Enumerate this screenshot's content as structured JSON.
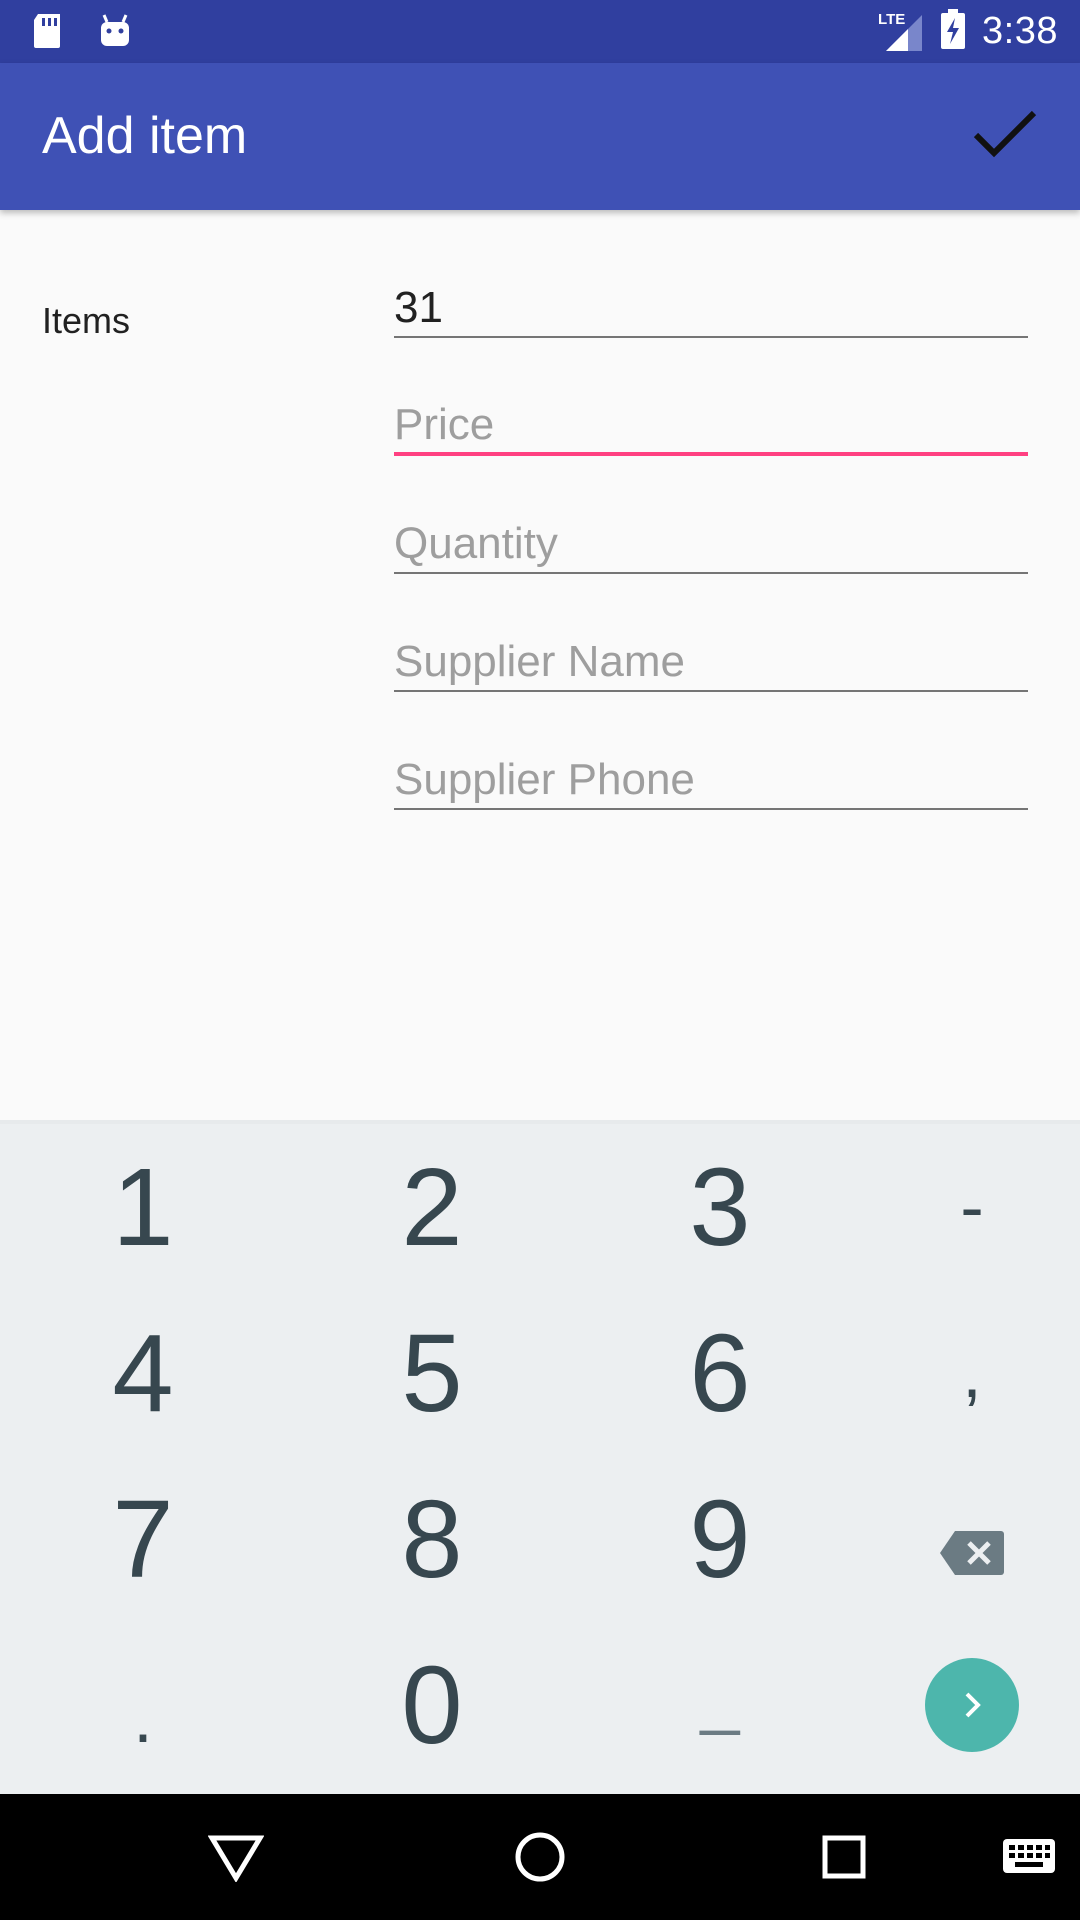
{
  "status_bar": {
    "network": "LTE",
    "time": "3:38",
    "icons": [
      "sd-card-icon",
      "android-debug-icon",
      "lte-signal-icon",
      "battery-charging-icon"
    ]
  },
  "app_bar": {
    "title": "Add item",
    "action_icon": "check-icon"
  },
  "form": {
    "items_label": "Items",
    "fields": [
      {
        "name": "items",
        "value": "31",
        "placeholder": ""
      },
      {
        "name": "price",
        "value": "",
        "placeholder": "Price",
        "focused": true
      },
      {
        "name": "quantity",
        "value": "",
        "placeholder": "Quantity"
      },
      {
        "name": "supplier_name",
        "value": "",
        "placeholder": "Supplier Name"
      },
      {
        "name": "supplier_phone",
        "value": "",
        "placeholder": "Supplier Phone"
      }
    ]
  },
  "keyboard": {
    "rows": [
      [
        "1",
        "2",
        "3",
        "-"
      ],
      [
        "4",
        "5",
        "6",
        ","
      ],
      [
        "7",
        "8",
        "9",
        "backspace"
      ],
      [
        ".",
        "0",
        "_",
        "next"
      ]
    ],
    "enter_color": "#4db6ac"
  },
  "nav_bar": {
    "icons": [
      "back-icon",
      "home-icon",
      "recents-icon",
      "keyboard-icon"
    ]
  },
  "colors": {
    "status_bar": "#303f9f",
    "app_bar": "#3f51b5",
    "accent": "#ff4081",
    "key_text": "#37474f"
  }
}
